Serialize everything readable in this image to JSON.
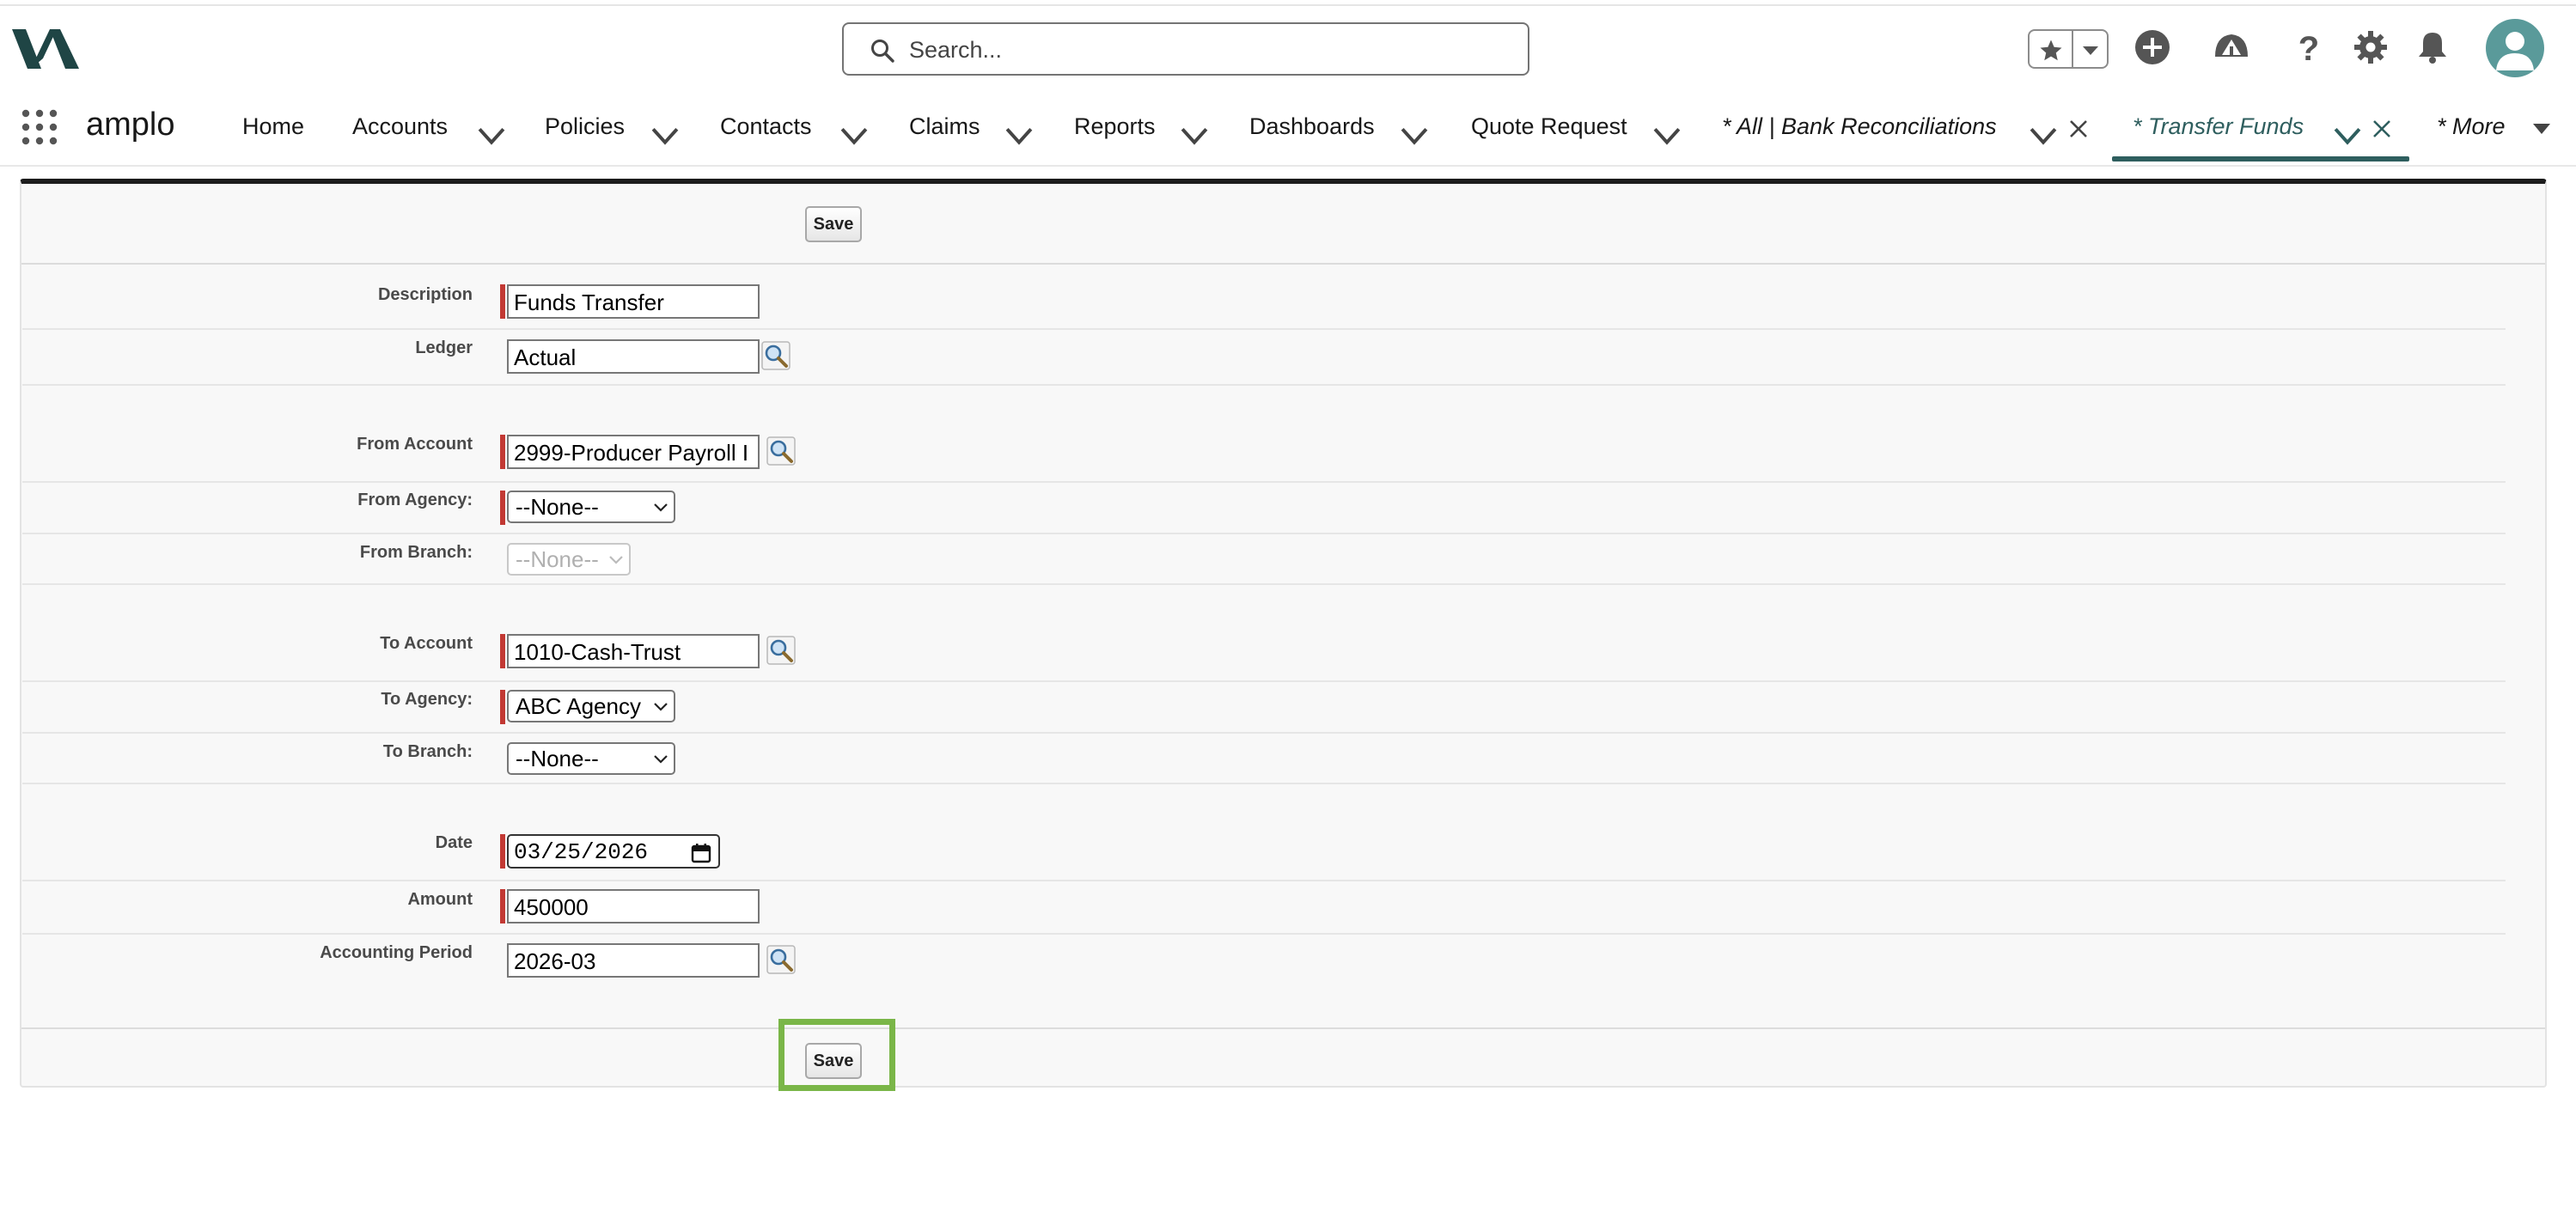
{
  "search": {
    "placeholder": "Search..."
  },
  "app": {
    "name": "amplo"
  },
  "nav": {
    "items": [
      {
        "label": "Home"
      },
      {
        "label": "Accounts"
      },
      {
        "label": "Policies"
      },
      {
        "label": "Contacts"
      },
      {
        "label": "Claims"
      },
      {
        "label": "Reports"
      },
      {
        "label": "Dashboards"
      },
      {
        "label": "Quote Request"
      }
    ],
    "tabs": [
      {
        "label": "* All | Bank Reconciliations"
      },
      {
        "label": "* Transfer Funds",
        "active": true
      }
    ],
    "more_label": "* More"
  },
  "form": {
    "save_top": "Save",
    "save_bottom": "Save",
    "fields": {
      "description": {
        "label": "Description",
        "value": "Funds Transfer"
      },
      "ledger": {
        "label": "Ledger",
        "value": "Actual"
      },
      "from_account": {
        "label": "From Account",
        "value": "2999-Producer Payroll I"
      },
      "from_agency": {
        "label": "From Agency:",
        "value": "--None--"
      },
      "from_branch": {
        "label": "From Branch:",
        "value": "--None--"
      },
      "to_account": {
        "label": "To Account",
        "value": "1010-Cash-Trust"
      },
      "to_agency": {
        "label": "To Agency:",
        "value": "ABC Agency"
      },
      "to_branch": {
        "label": "To Branch:",
        "value": "--None--"
      },
      "date": {
        "label": "Date",
        "value": "03/25/2026"
      },
      "amount": {
        "label": "Amount",
        "value": "450000"
      },
      "accounting_period": {
        "label": "Accounting Period",
        "value": "2026-03"
      }
    }
  },
  "colors": {
    "brand": "#2e5e5e",
    "required": "#c23934",
    "highlight": "#7ab648"
  }
}
